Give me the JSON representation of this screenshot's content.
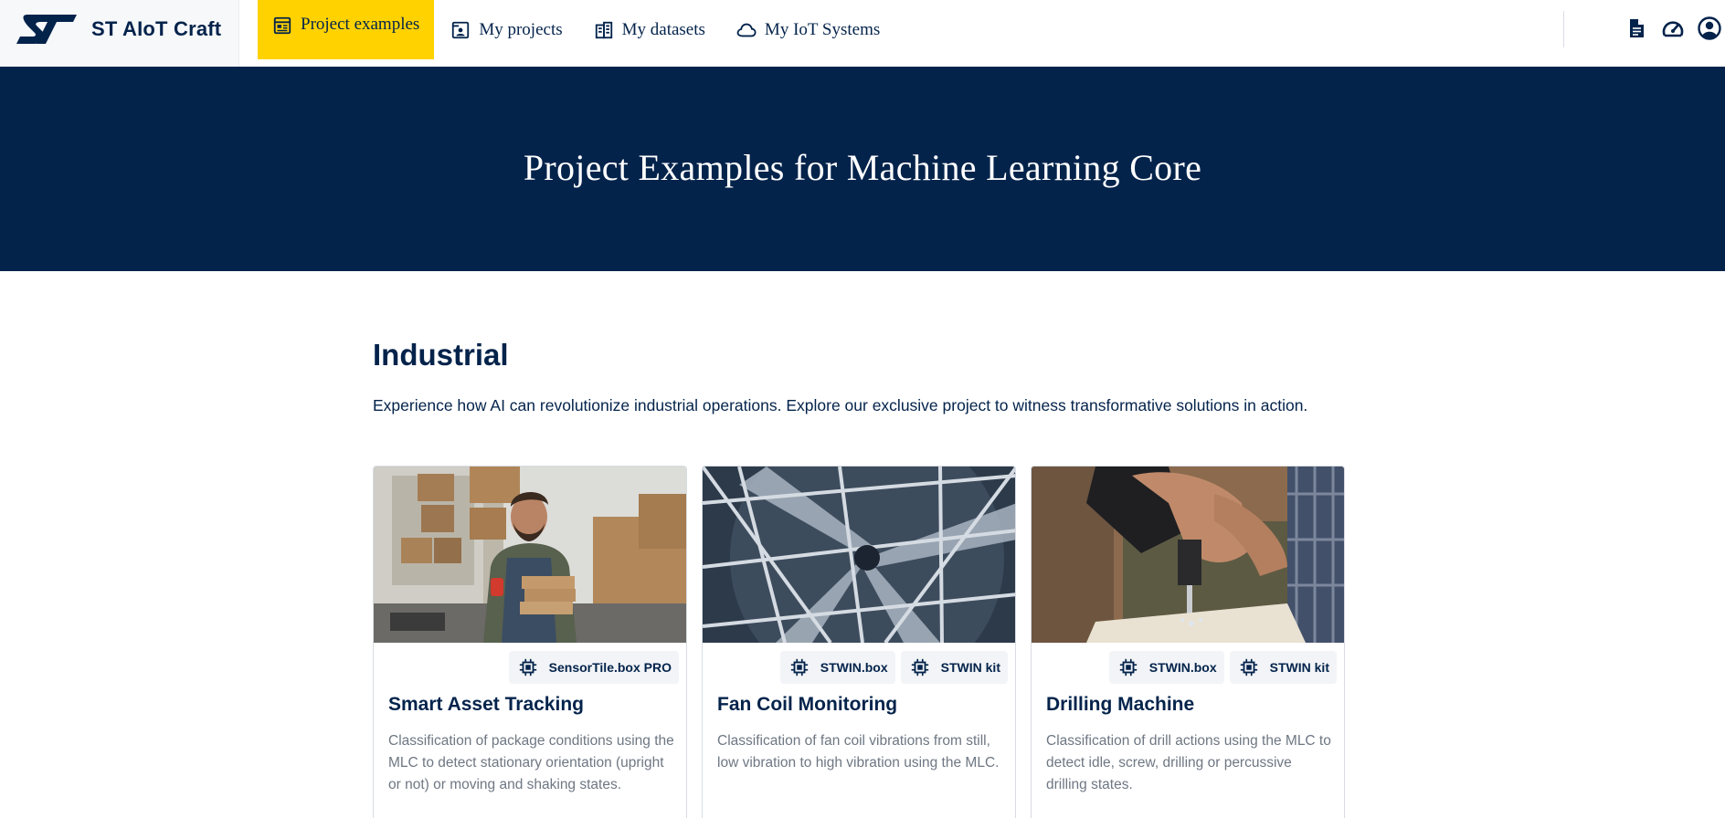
{
  "app": {
    "name": "ST AIoT Craft"
  },
  "nav": {
    "items": [
      {
        "label": "Project examples",
        "icon": "project-examples-icon",
        "active": true
      },
      {
        "label": "My projects",
        "icon": "my-projects-icon",
        "active": false
      },
      {
        "label": "My datasets",
        "icon": "my-datasets-icon",
        "active": false
      },
      {
        "label": "My IoT Systems",
        "icon": "cloud-icon",
        "active": false
      }
    ]
  },
  "top_actions": [
    "document-icon",
    "speedometer-icon",
    "account-icon"
  ],
  "hero": {
    "title": "Project Examples for Machine Learning Core"
  },
  "section": {
    "title": "Industrial",
    "description": "Experience how AI can revolutionize industrial operations. Explore our exclusive project to witness transformative solutions in action."
  },
  "cards": [
    {
      "title": "Smart Asset Tracking",
      "tags": [
        "SensorTile.box PRO"
      ],
      "description": "Classification of package conditions using the MLC to detect stationary orientation (upright or not) or moving and shaking states.",
      "image": "warehouse-worker-photo"
    },
    {
      "title": "Fan Coil Monitoring",
      "tags": [
        "STWIN.box",
        "STWIN kit"
      ],
      "description": "Classification of fan coil vibrations from still, low vibration to high vibration using the MLC.",
      "image": "industrial-fan-photo"
    },
    {
      "title": "Drilling Machine",
      "tags": [
        "STWIN.box",
        "STWIN kit"
      ],
      "description": "Classification of drill actions using the MLC to detect idle, screw, drilling or percussive drilling states.",
      "image": "drill-photo"
    }
  ],
  "colors": {
    "navy": "#03234b",
    "accent_yellow": "#ffd200",
    "muted_text": "#6e7783",
    "tag_bg": "#f2f4f7"
  }
}
